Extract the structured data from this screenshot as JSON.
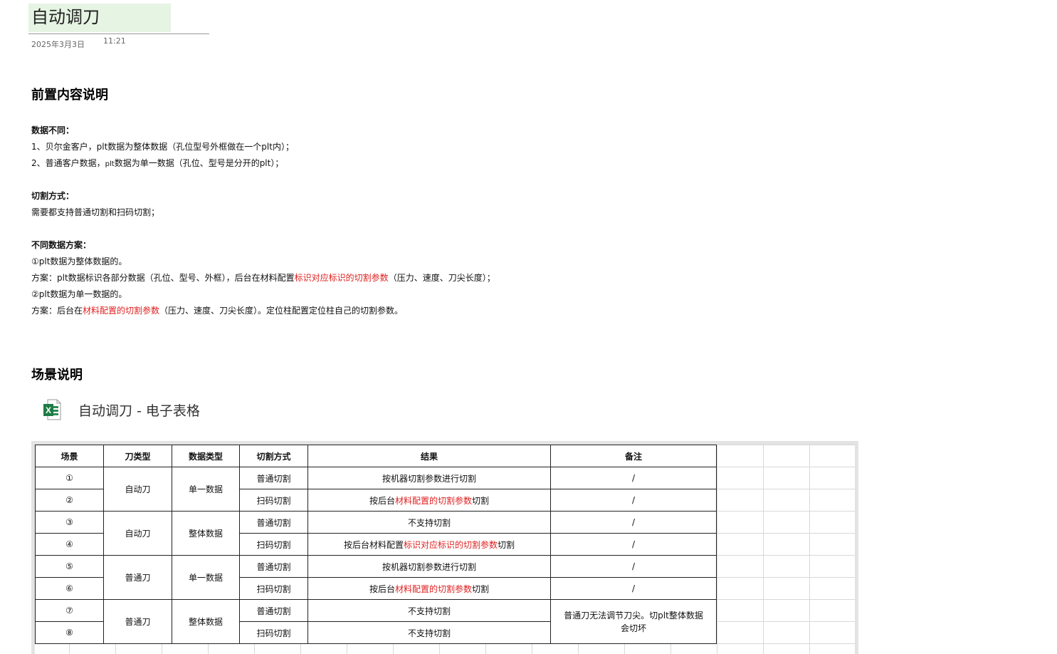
{
  "page": {
    "title": "自动调刀",
    "date": "2025年3月3日",
    "time": "11:21"
  },
  "section1": {
    "heading": "前置内容说明",
    "data_diff_label": "数据不同：",
    "data_diff_1": "1、贝尔金客户，plt数据为整体数据（孔位型号外框做在一个plt内）；",
    "data_diff_2_pre": "2、普通客户数据，",
    "data_diff_2_small": "plt",
    "data_diff_2_post": "数据为单一数据（孔位、型号是分开的plt）；",
    "cut_label": "切割方式：",
    "cut_text": "需要都支持普通切割和扫码切割；",
    "plan_label": "不同数据方案：",
    "plan_1": "①plt数据为整体数据的。",
    "plan_1_pre": "方案：plt数据标识各部分数据（孔位、型号、外框），后台在材料配置",
    "plan_1_red": "标识对应标识的切割参数",
    "plan_1_post": "（压力、速度、刀尖长度）；",
    "plan_2": "②plt数据为单一数据的。",
    "plan_2_pre": "方案：后台在",
    "plan_2_red": "材料配置的切割参数",
    "plan_2_post": "（压力、速度、刀尖长度）。定位柱配置定位柱自己的切割参数。"
  },
  "section2": {
    "heading": "场景说明",
    "attachment": {
      "icon": "excel-icon",
      "name": "自动调刀 - 电子表格"
    }
  },
  "table": {
    "headers": [
      "场景",
      "刀类型",
      "数据类型",
      "切割方式",
      "结果",
      "备注"
    ],
    "groups": [
      {
        "knife": "自动刀",
        "data_type": "单一数据"
      },
      {
        "knife": "自动刀",
        "data_type": "整体数据"
      },
      {
        "knife": "普通刀",
        "data_type": "单一数据"
      },
      {
        "knife": "普通刀",
        "data_type": "整体数据"
      }
    ],
    "rows": [
      {
        "scene": "①",
        "cut": "普通切割",
        "result_pre": "按机器切割参数进行切割",
        "result_red": "",
        "result_post": "",
        "note": "/"
      },
      {
        "scene": "②",
        "cut": "扫码切割",
        "result_pre": "按后台",
        "result_red": "材料配置的切割参数",
        "result_post": "切割",
        "note": "/"
      },
      {
        "scene": "③",
        "cut": "普通切割",
        "result_pre": "不支持切割",
        "result_red": "",
        "result_post": "",
        "note": "/"
      },
      {
        "scene": "④",
        "cut": "扫码切割",
        "result_pre": "按后台材料配置",
        "result_red": "标识对应标识的切割参数",
        "result_post": "切割",
        "note": "/"
      },
      {
        "scene": "⑤",
        "cut": "普通切割",
        "result_pre": "按机器切割参数进行切割",
        "result_red": "",
        "result_post": "",
        "note": "/"
      },
      {
        "scene": "⑥",
        "cut": "扫码切割",
        "result_pre": "按后台",
        "result_red": "材料配置的切割参数",
        "result_post": "切割",
        "note": "/"
      },
      {
        "scene": "⑦",
        "cut": "普通切割",
        "result_pre": "不支持切割",
        "result_red": "",
        "result_post": "",
        "note": ""
      },
      {
        "scene": "⑧",
        "cut": "扫码切割",
        "result_pre": "不支持切割",
        "result_red": "",
        "result_post": "",
        "note": ""
      }
    ],
    "merged_note_line1": "普通刀无法调节刀尖。切plt整体数据",
    "merged_note_line2": "会切坏"
  },
  "colors": {
    "title_bg": "#e6f4e3",
    "highlight_red": "#e02020",
    "excel_green": "#1e7b45"
  }
}
